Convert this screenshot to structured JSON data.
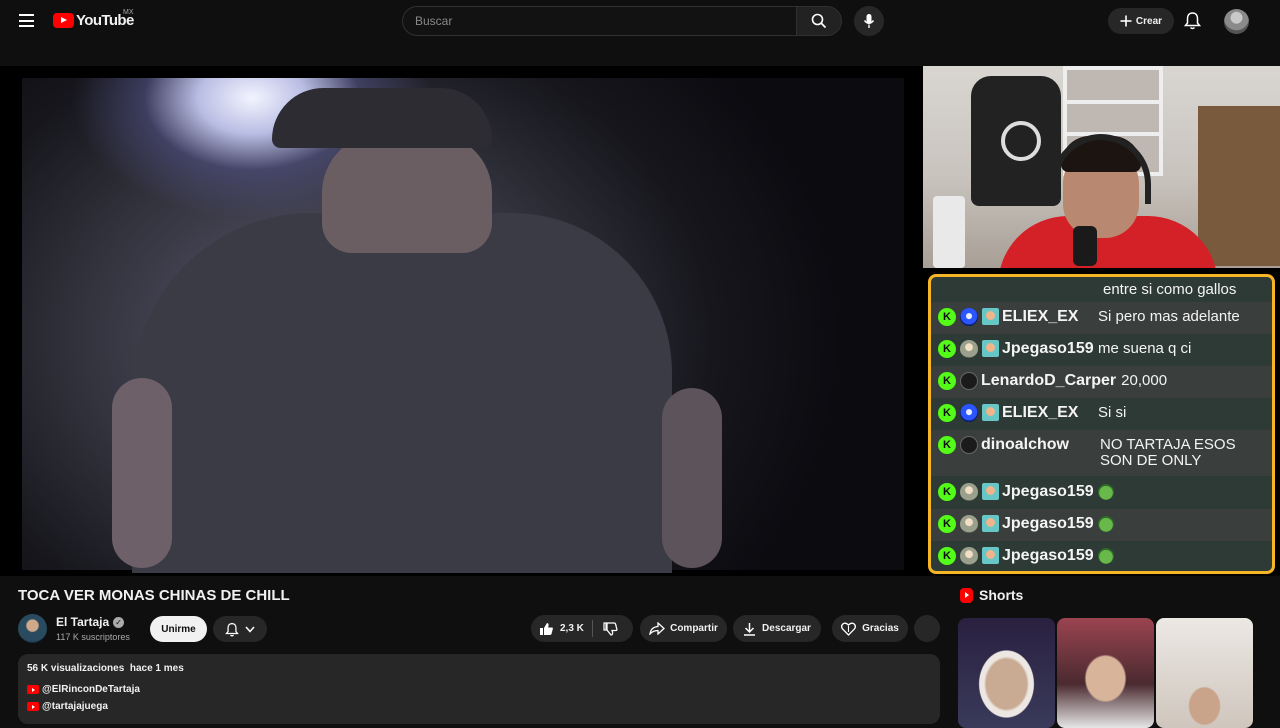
{
  "header": {
    "logo_text": "YouTube",
    "country_code": "MX",
    "search_placeholder": "Buscar",
    "create_label": "Crear"
  },
  "video": {
    "title": "TOCA VER MONAS CHINAS DE CHILL"
  },
  "chat": {
    "rows": [
      {
        "user": "",
        "message": "entre si como gallos",
        "avatar": "none"
      },
      {
        "user": "ELIEX_EX",
        "message": "Si pero mas adelante",
        "avatar": "blue"
      },
      {
        "user": "Jpegaso159",
        "message": "me suena q ci",
        "avatar": "pic"
      },
      {
        "user": "LenardoD_Carper",
        "message": "20,000",
        "avatar": "dark"
      },
      {
        "user": "ELIEX_EX",
        "message": "Si si",
        "avatar": "blue"
      },
      {
        "user": "dinoalchow",
        "message": "NO TARTAJA ESOS SON DE ONLY",
        "avatar": "dark"
      },
      {
        "user": "Jpegaso159",
        "message": "",
        "avatar": "pic",
        "emote": "frog-emote"
      },
      {
        "user": "Jpegaso159",
        "message": "",
        "avatar": "pic",
        "emote": "frog-emote"
      },
      {
        "user": "Jpegaso159",
        "message": "",
        "avatar": "pic",
        "emote": "frog-emote"
      }
    ],
    "kick_letter": "K",
    "border_color": "#f5b525"
  },
  "channel": {
    "name": "El Tartaja",
    "subscribers": "117 K suscriptores",
    "join_label": "Unirme"
  },
  "actions": {
    "likes": "2,3 K",
    "share_label": "Compartir",
    "download_label": "Descargar",
    "thanks_label": "Gracias"
  },
  "description": {
    "views": "56 K visualizaciones",
    "age": "hace 1 mes",
    "links": [
      "@ElRinconDeTartaja",
      "@tartajajuega"
    ]
  },
  "shorts": {
    "heading": "Shorts"
  },
  "colors": {
    "brand_red": "#ff0000",
    "kick_green": "#53fc18"
  }
}
